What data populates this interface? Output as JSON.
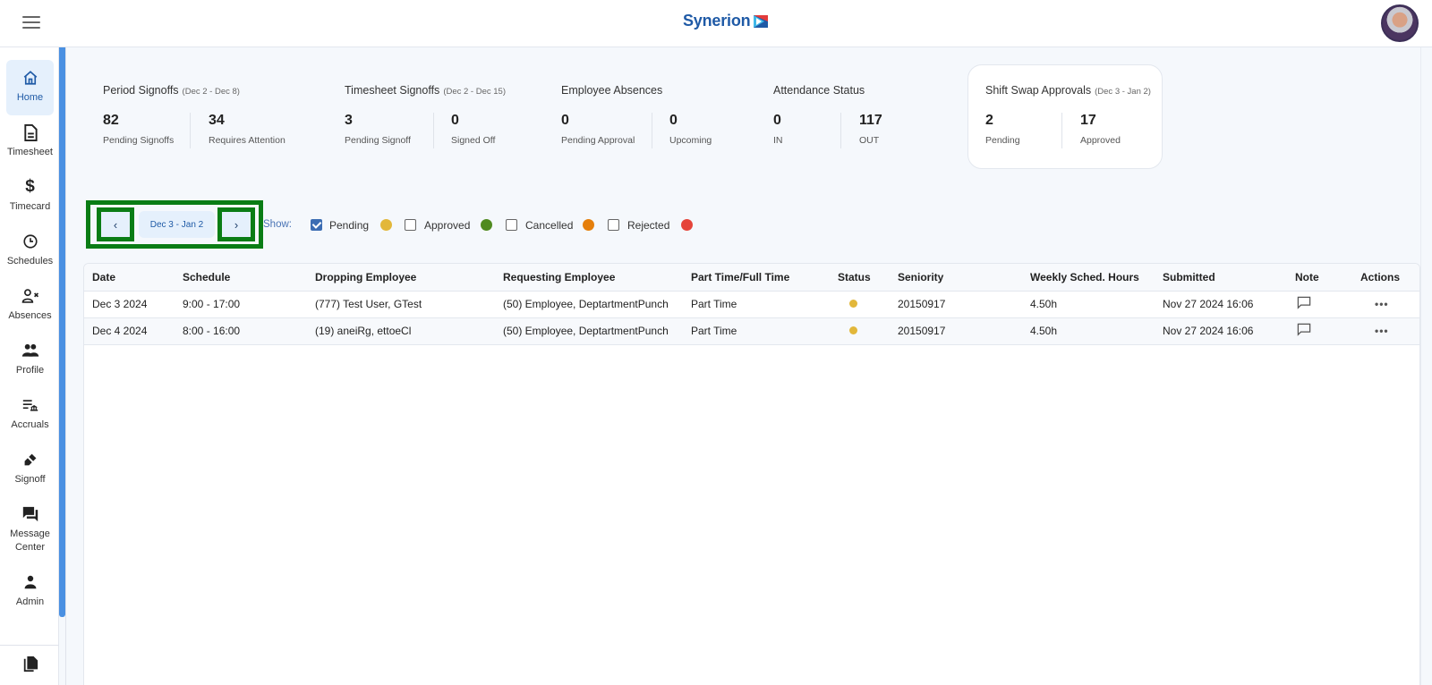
{
  "header": {
    "menu_icon": "hamburger-icon",
    "brand": "Synerion",
    "avatar_alt": "user-avatar"
  },
  "sidebar": {
    "items": [
      {
        "label": "Home",
        "icon": "home-icon",
        "active": true
      },
      {
        "label": "Timesheet",
        "icon": "document-icon"
      },
      {
        "label": "Timecard",
        "icon": "dollar-icon"
      },
      {
        "label": "Schedules",
        "icon": "clock-icon"
      },
      {
        "label": "Absences",
        "icon": "person-x-icon"
      },
      {
        "label": "Profile",
        "icon": "people-icon"
      },
      {
        "label": "Accruals",
        "icon": "accruals-icon"
      },
      {
        "label": "Signoff",
        "icon": "signoff-icon"
      },
      {
        "label": "Message Center",
        "icon": "chat-icon"
      },
      {
        "label": "Admin",
        "icon": "person-icon"
      },
      {
        "label": "",
        "icon": "copy-icon"
      }
    ]
  },
  "kpis": [
    {
      "title": "Period Signoffs",
      "range": "(Dec 2 - Dec 8)",
      "stats": [
        {
          "value": "82",
          "label": "Pending Signoffs"
        },
        {
          "value": "34",
          "label": "Requires Attention"
        }
      ]
    },
    {
      "title": "Timesheet Signoffs",
      "range": "(Dec 2 - Dec 15)",
      "stats": [
        {
          "value": "3",
          "label": "Pending Signoff"
        },
        {
          "value": "0",
          "label": "Signed Off"
        }
      ]
    },
    {
      "title": "Employee Absences",
      "range": "",
      "stats": [
        {
          "value": "0",
          "label": "Pending Approval"
        },
        {
          "value": "0",
          "label": "Upcoming"
        }
      ]
    },
    {
      "title": "Attendance Status",
      "range": "",
      "stats": [
        {
          "value": "0",
          "label": "IN"
        },
        {
          "value": "117",
          "label": "OUT"
        }
      ]
    },
    {
      "title": "Shift Swap Approvals",
      "range": "(Dec 3 - Jan 2)",
      "stats": [
        {
          "value": "2",
          "label": "Pending"
        },
        {
          "value": "17",
          "label": "Approved"
        }
      ],
      "selected": true
    }
  ],
  "filters": {
    "prev_label": "‹",
    "next_label": "›",
    "date_range": "Dec 3 - Jan 2",
    "show_label": "Show:",
    "options": [
      {
        "label": "Pending",
        "checked": true,
        "color": "#e2b73a"
      },
      {
        "label": "Approved",
        "checked": false,
        "color": "#4f8a1f"
      },
      {
        "label": "Cancelled",
        "checked": false,
        "color": "#e57f0c"
      },
      {
        "label": "Rejected",
        "checked": false,
        "color": "#e5443a"
      }
    ]
  },
  "table": {
    "columns": [
      "Date",
      "Schedule",
      "Dropping Employee",
      "Requesting Employee",
      "Part Time/Full Time",
      "Status",
      "Seniority",
      "Weekly Sched. Hours",
      "Submitted",
      "Note",
      "Actions"
    ],
    "rows": [
      {
        "date": "Dec 3 2024",
        "schedule": "9:00 - 17:00",
        "dropping": "(777) Test User, GTest",
        "requesting": "(50) Employee, DeptartmentPunch",
        "pt_ft": "Part Time",
        "status": "Pending",
        "status_color": "#e2b73a",
        "seniority": "20150917",
        "hours": "4.50h",
        "submitted": "Nov 27 2024 16:06",
        "actions": "•••"
      },
      {
        "date": "Dec 4 2024",
        "schedule": "8:00 - 16:00",
        "dropping": "(19) aneiRg, ettoeCl",
        "requesting": "(50) Employee, DeptartmentPunch",
        "pt_ft": "Part Time",
        "status": "Pending",
        "status_color": "#e2b73a",
        "seniority": "20150917",
        "hours": "4.50h",
        "submitted": "Nov 27 2024 16:06",
        "actions": "•••"
      }
    ]
  }
}
